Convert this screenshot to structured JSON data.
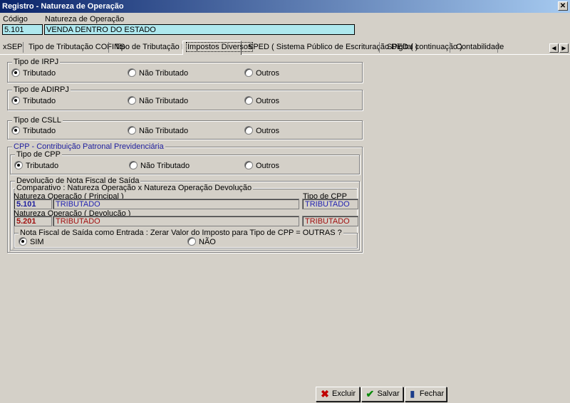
{
  "window": {
    "title": "Registro - Natureza de Operação",
    "close": "✕"
  },
  "header": {
    "codigo_label": "Código",
    "codigo_value": "5.101",
    "natureza_label": "Natureza de Operação",
    "natureza_value": "VENDA DENTRO DO ESTADO"
  },
  "tabs": [
    {
      "label": "xSEP"
    },
    {
      "label": "Tipo de Tributação COFINS"
    },
    {
      "label": "Tipo de Tributação ISS"
    },
    {
      "label": "Impostos Diversos"
    },
    {
      "label": "SPED ( Sistema Público de Escrituração Digital )"
    },
    {
      "label": "SPED ( continuação )"
    },
    {
      "label": "Contabilidade"
    }
  ],
  "groups": {
    "irpj": {
      "title": "Tipo de IRPJ",
      "options": [
        "Tributado",
        "Não Tributado",
        "Outros"
      ],
      "selected": "Tributado"
    },
    "adirpj": {
      "title": "Tipo de ADIRPJ",
      "options": [
        "Tributado",
        "Não Tributado",
        "Outros"
      ],
      "selected": "Tributado"
    },
    "csll": {
      "title": "Tipo de CSLL",
      "options": [
        "Tributado",
        "Não Tributado",
        "Outros"
      ],
      "selected": "Tributado"
    },
    "cpp": {
      "title": "CPP - Contribuição Patronal Previdenciária",
      "tipo_title": "Tipo de CPP",
      "options": [
        "Tributado",
        "Não Tributado",
        "Outros"
      ],
      "selected": "Tributado",
      "devolucao": {
        "title": "Devolução de Nota Fiscal de Saída",
        "comparativo_title": "Comparativo : Natureza Operação x Natureza Operação Devolução",
        "principal_label": "Natureza Operação ( Principal )",
        "tipo_cpp_label": "Tipo de CPP",
        "principal_code": "5.101",
        "principal_desc": "TRIBUTADO",
        "principal_tipo": "TRIBUTADO",
        "devolucao_label": "Natureza Operação ( Devolução )",
        "devolucao_code": "5.201",
        "devolucao_desc": "TRIBUTADO",
        "devolucao_tipo": "TRIBUTADO",
        "zerar_title": "Nota Fiscal de Saída como Entrada : Zerar Valor do Imposto para Tipo de CPP = OUTRAS ?",
        "zerar_options": [
          "SIM",
          "NÃO"
        ],
        "zerar_selected": "SIM"
      }
    }
  },
  "buttons": {
    "excluir": "Excluir",
    "salvar": "Salvar",
    "fechar": "Fechar"
  },
  "colors": {
    "titlebar": "#0a246a",
    "input_bg": "#aee8ee",
    "blue_text": "#2424b0",
    "red_text": "#a01010"
  }
}
